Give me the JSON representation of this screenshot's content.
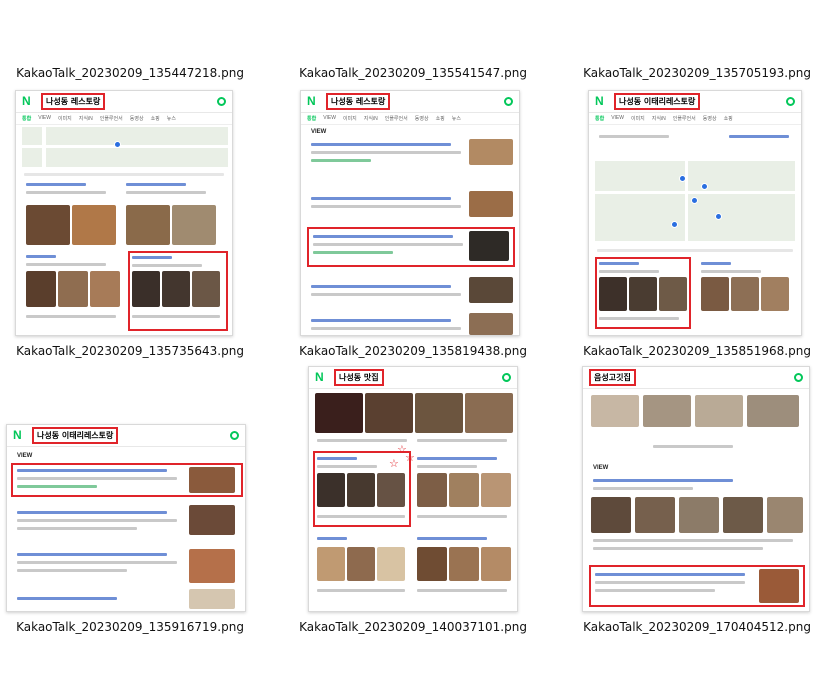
{
  "files": [
    {
      "name": "KakaoTalk_20230209_135447218.png"
    },
    {
      "name": "KakaoTalk_20230209_135541547.png"
    },
    {
      "name": "KakaoTalk_20230209_135705193.png"
    },
    {
      "name": "KakaoTalk_20230209_135735643.png"
    },
    {
      "name": "KakaoTalk_20230209_135819438.png"
    },
    {
      "name": "KakaoTalk_20230209_135851968.png"
    },
    {
      "name": "KakaoTalk_20230209_135916719.png"
    },
    {
      "name": "KakaoTalk_20230209_140037101.png"
    },
    {
      "name": "KakaoTalk_20230209_170404512.png"
    }
  ],
  "thumbs": [
    {
      "query": "나성동 레스토랑",
      "logo": "N"
    },
    {
      "query": "나성동 레스토랑",
      "logo": "N"
    },
    {
      "query": "나성동 이태리레스토랑",
      "logo": "N"
    },
    {
      "query": "나성동 이태리레스토랑",
      "logo": "N"
    },
    {
      "query": "나성동 맛집",
      "logo": "N"
    },
    {
      "query": "음성고깃집",
      "logo": ""
    }
  ],
  "tabs": [
    "통합",
    "VIEW",
    "이미지",
    "지식iN",
    "인플루언서",
    "동영상",
    "쇼핑",
    "뉴스",
    "어학사전",
    "지도"
  ],
  "view_label": "VIEW",
  "colors": {
    "naver_green": "#03c75a",
    "highlight_red": "#e0242a"
  }
}
